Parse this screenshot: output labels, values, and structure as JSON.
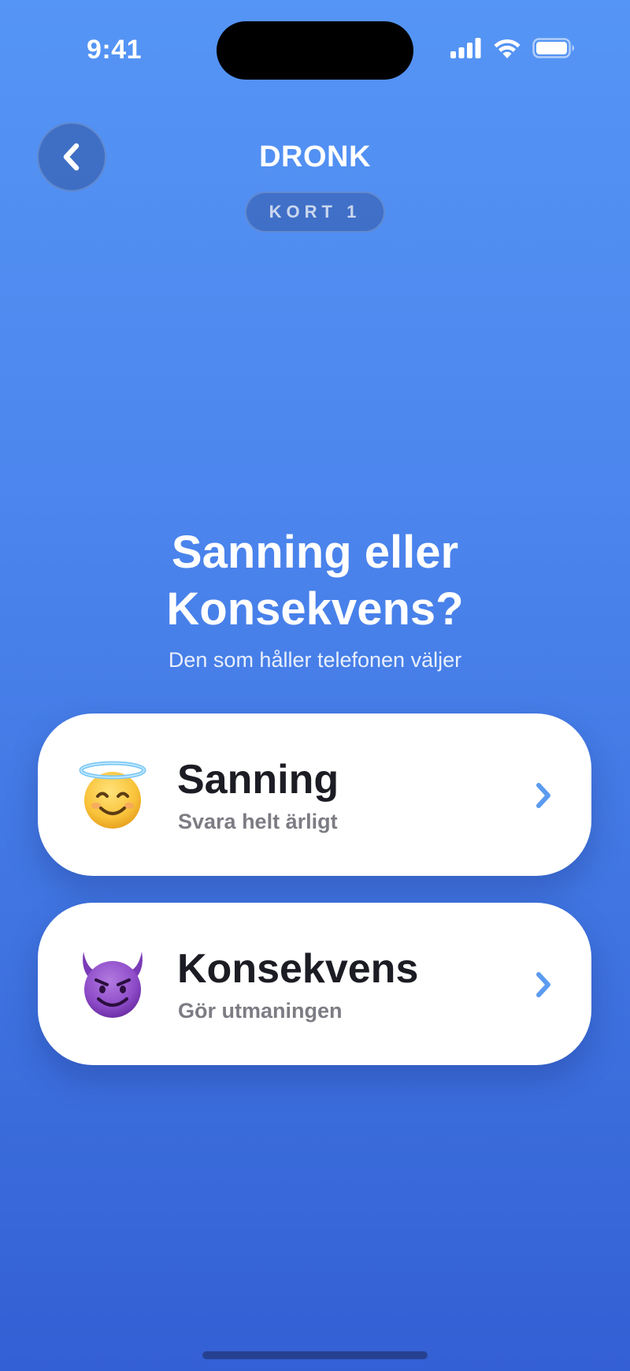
{
  "status_bar": {
    "time": "9:41"
  },
  "header": {
    "title": "DRONK",
    "card_label": "KORT 1"
  },
  "question": {
    "title_line1": "Sanning eller",
    "title_line2": "Konsekvens?",
    "subtitle": "Den som håller telefonen väljer"
  },
  "options": [
    {
      "title": "Sanning",
      "subtitle": "Svara helt ärligt",
      "icon": "smiling-face-with-halo-icon"
    },
    {
      "title": "Konsekvens",
      "subtitle": "Gör utmaningen",
      "icon": "smiling-devil-icon"
    }
  ],
  "colors": {
    "background_top": "#5595f5",
    "background_bottom": "#3360d4",
    "card_background": "#ffffff",
    "chevron": "#5b9bf0",
    "title_text": "#1c1c24",
    "subtitle_text": "#7c7c84"
  }
}
